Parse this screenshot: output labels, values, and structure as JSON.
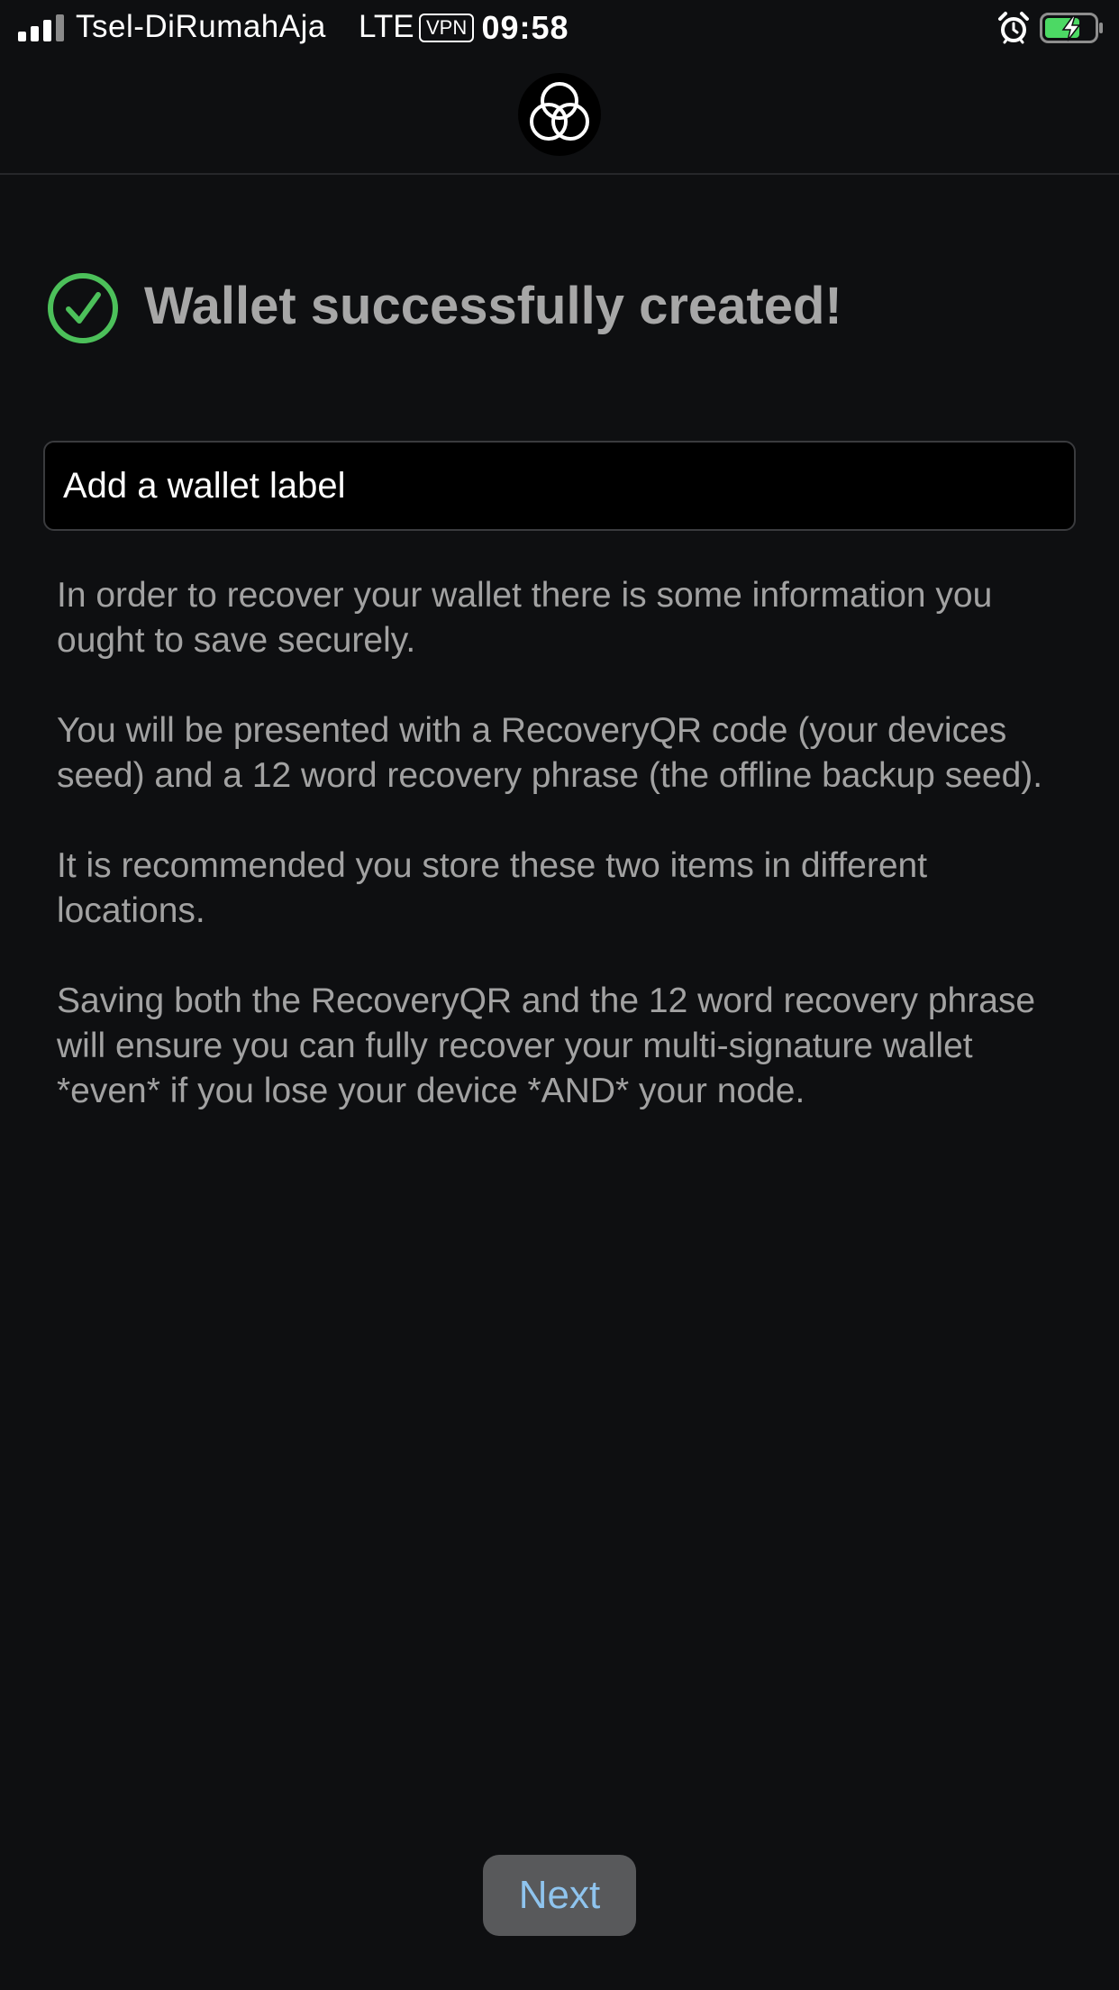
{
  "status_bar": {
    "carrier": "Tsel-DiRumahAja",
    "network": "LTE",
    "vpn": "VPN",
    "time": "09:58",
    "icons": [
      "signal-icon",
      "alarm-icon",
      "battery-charging-icon"
    ],
    "battery_color": "#4cd964"
  },
  "header": {
    "logo_icon": "three-rings-logo-icon"
  },
  "success": {
    "icon": "check-circle-icon",
    "icon_color": "#4cc05a",
    "title": "Wallet successfully created!"
  },
  "wallet_label": {
    "placeholder": "Add a wallet label",
    "value": ""
  },
  "info": {
    "paragraphs": [
      "In order to recover your wallet there is some information you ought to save securely.",
      "You will be presented with a RecoveryQR code (your devices seed) and a 12 word recovery phrase (the offline backup seed).",
      "It is recommended you store these two items in different locations.",
      "Saving both the RecoveryQR and the 12 word recovery phrase will ensure you can fully recover your multi-signature wallet *even* if you lose your device *AND* your node."
    ]
  },
  "footer": {
    "next_label": "Next",
    "next_color": "#8fc4ee"
  }
}
